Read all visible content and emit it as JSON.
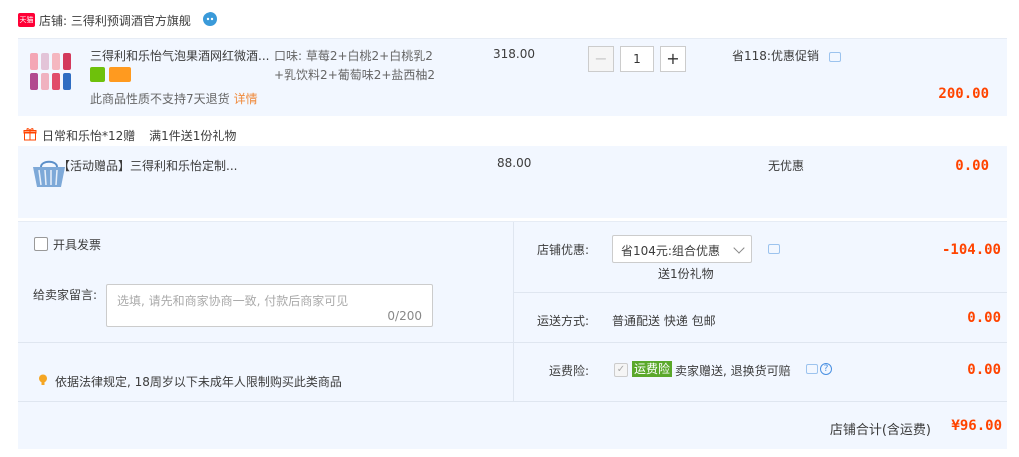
{
  "store": {
    "badge": "天猫",
    "name": "店铺: 三得利预调酒官方旗舰"
  },
  "item": {
    "title": "三得利和乐怡气泡果酒网红微酒...",
    "no_return": "此商品性质不支持7天退货",
    "detail_link": "详情",
    "sku_line1": "口味: 草莓2+白桃2+白桃乳2",
    "sku_line2": "+乳饮料2+葡萄味2+盐西柚2",
    "price": "318.00",
    "quantity": "1",
    "minus": "−",
    "plus": "+",
    "promo": "省118:优惠促销",
    "subtotal": "200.00"
  },
  "gift_section": {
    "title": "日常和乐怡*12赠",
    "rule": "满1件送1份礼物",
    "item_title": "【活动赠品】三得利和乐怡定制...",
    "price": "88.00",
    "promo": "无优惠",
    "subtotal": "0.00"
  },
  "order": {
    "invoice_label": "开具发票",
    "message_label": "给卖家留言:",
    "message_placeholder": "选填, 请先和商家协商一致, 付款后商家可见",
    "message_count": "0/200",
    "law_notice": "依据法律规定, 18周岁以下未成年人限制购买此类商品",
    "store_discount_label": "店铺优惠:",
    "store_discount_value": "省104元:组合优惠",
    "store_discount_note": "送1份礼物",
    "store_discount_amount": "-104.00",
    "shipping_label": "运送方式:",
    "shipping_value": "普通配送 快递 包邮",
    "shipping_amount": "0.00",
    "insurance_label": "运费险:",
    "insurance_badge": "运费险",
    "insurance_text": "卖家赠送, 退换货可赔",
    "insurance_amount": "0.00",
    "total_label": "店铺合计(含运费)",
    "total_amount": "¥96.00"
  },
  "colors": {
    "accent_red": "#ff4400",
    "tmall_red": "#ff0036",
    "panel_bg": "#f2f7ff",
    "insurance_green": "#5aa82a"
  }
}
